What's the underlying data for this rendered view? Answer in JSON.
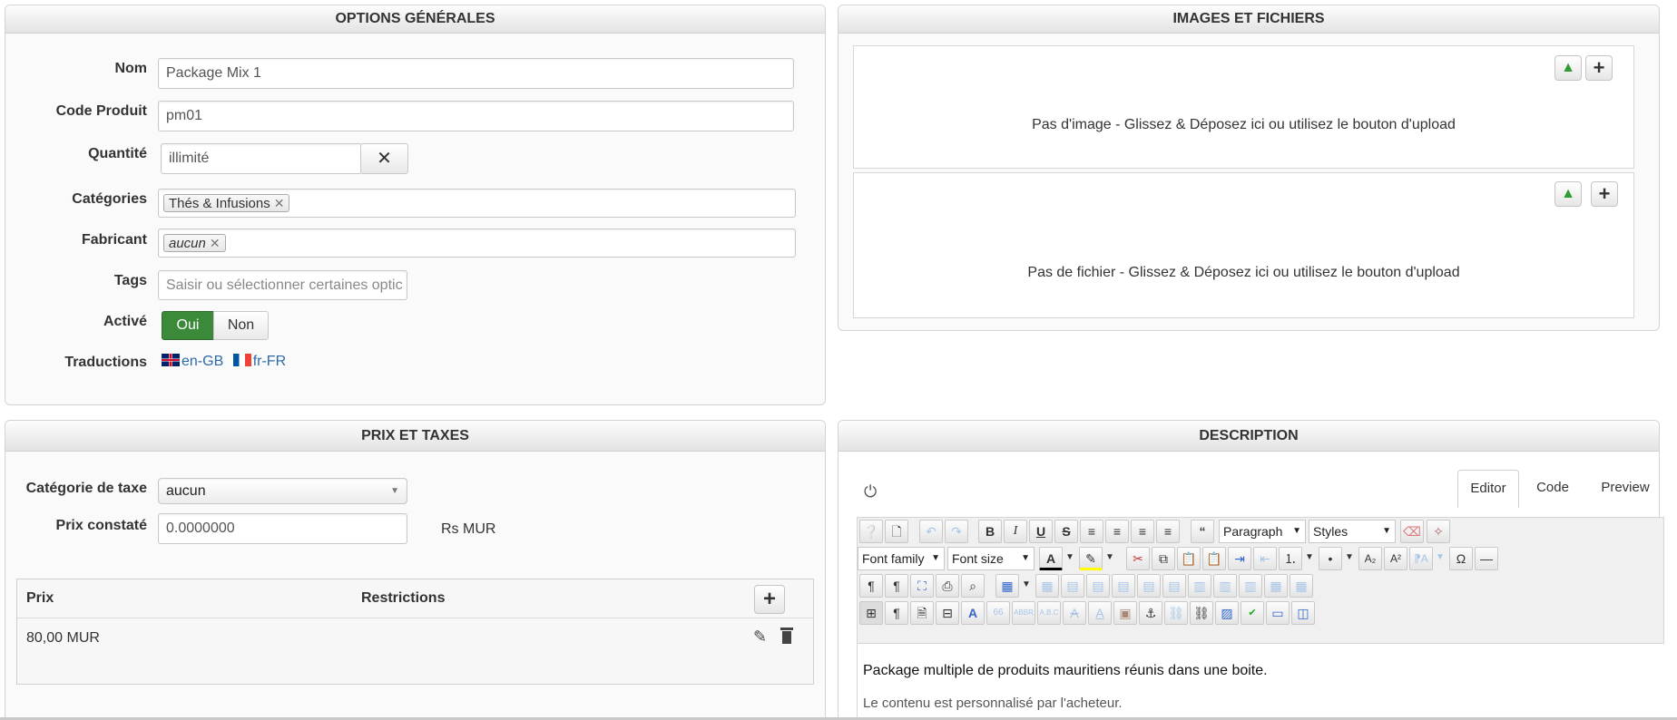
{
  "general": {
    "title": "OPTIONS GÉNÉRALES",
    "name_label": "Nom",
    "name_value": "Package Mix 1",
    "code_label": "Code Produit",
    "code_value": "pm01",
    "qty_label": "Quantité",
    "qty_value": "illimité",
    "cat_label": "Catégories",
    "cat_chip": "Thés & Infusions",
    "maker_label": "Fabricant",
    "maker_chip": "aucun",
    "tags_label": "Tags",
    "tags_placeholder": "Saisir ou sélectionner certaines optic",
    "active_label": "Activé",
    "active_yes": "Oui",
    "active_no": "Non",
    "trans_label": "Traductions",
    "trans_en": "en-GB",
    "trans_fr": "fr-FR"
  },
  "images": {
    "title": "IMAGES ET FICHIERS",
    "no_image": "Pas d'image - Glissez & Déposez ici ou utilisez le bouton d'upload",
    "no_file": "Pas de fichier - Glissez & Déposez ici ou utilisez le bouton d'upload"
  },
  "prices": {
    "title": "PRIX ET TAXES",
    "tax_label": "Catégorie de taxe",
    "tax_value": "aucun",
    "list_label": "Prix constaté",
    "list_value": "0.0000000",
    "currency": "Rs MUR",
    "col_price": "Prix",
    "col_restrict": "Restrictions",
    "row_price": "80,00 MUR"
  },
  "description": {
    "title": "DESCRIPTION",
    "tabs": [
      "Editor",
      "Code",
      "Preview"
    ],
    "paragraph": "Paragraph",
    "styles": "Styles",
    "font_family": "Font family",
    "font_size": "Font size",
    "text1": "Package multiple de produits mauritiens réunis dans une boite.",
    "text2": "Le contenu est personnalisé par l'acheteur."
  },
  "colors": {
    "active_green": "#3a8a3a",
    "link_blue": "#2f6aa8"
  }
}
